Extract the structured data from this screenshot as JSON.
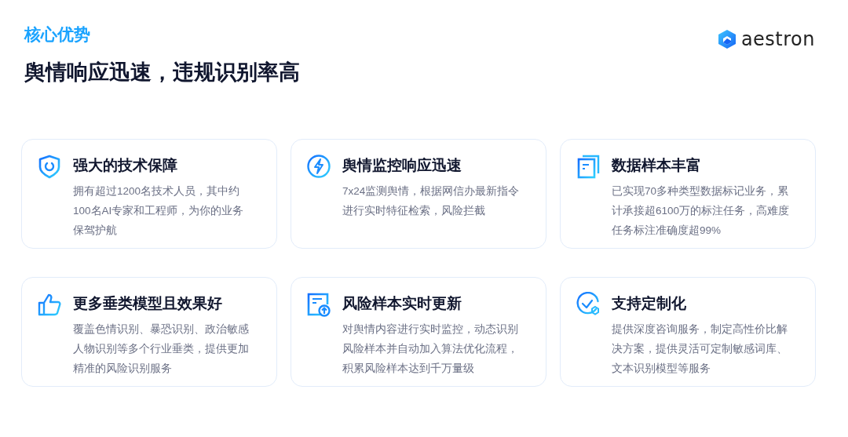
{
  "header": {
    "eyebrow": "核心优势",
    "title": "舆情响应迅速，违规识别率高",
    "logo_text": "aestron"
  },
  "cards": [
    {
      "title": "强大的技术保障",
      "text": "拥有超过1200名技术人员，其中约100名AI专家和工程师，为你的业务保驾护航"
    },
    {
      "title": "舆情监控响应迅速",
      "text": "7x24监测舆情，根据网信办最新指令进行实时特征检索，风险拦截"
    },
    {
      "title": "数据样本丰富",
      "text": "已实现70多种类型数据标记业务，累计承接超6100万的标注任务，高难度任务标注准确度超99%"
    },
    {
      "title": "更多垂类模型且效果好",
      "text": "覆盖色情识别、暴恐识别、政治敏感人物识别等多个行业垂类，提供更加精准的风险识别服务"
    },
    {
      "title": "风险样本实时更新",
      "text": "对舆情内容进行实时监控，动态识别风险样本并自动加入算法优化流程，积累风险样本达到千万量级"
    },
    {
      "title": "支持定制化",
      "text": "提供深度咨询服务，制定高性价比解决方案，提供灵活可定制敏感词库、文本识别模型等服务"
    }
  ]
}
